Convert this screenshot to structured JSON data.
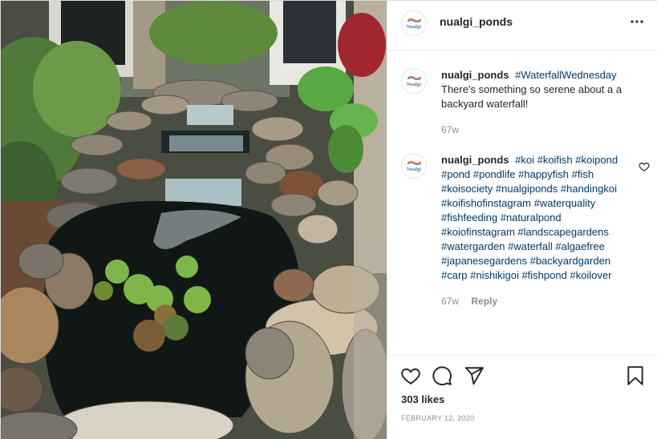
{
  "header": {
    "username": "nualgi_ponds",
    "avatar_icon": "nualgi-logo-icon",
    "avatar_text": "Nualgi",
    "more_icon": "more-options-icon"
  },
  "caption": {
    "username": "nualgi_ponds",
    "hashtag": "#WaterfallWednesday",
    "text": "There's something so serene about a a backyard waterfall!",
    "time": "67w"
  },
  "comment": {
    "username": "nualgi_ponds",
    "hashtags": "#koi #koifish #koipond #pond #pondlife #happyfish #fish #koisociety #nualgiponds #handingkoi #koifishofinstagram #waterquality #fishfeeding #naturalpond #koiofinstagram #landscapegardens #watergarden #waterfall #algaefree #japanesegardens #backyardgarden #carp #nishikigoi #fishpond #koilover",
    "time": "67w",
    "reply_label": "Reply",
    "like_icon": "heart-outline-icon"
  },
  "actions": {
    "like_icon": "heart-icon",
    "comment_icon": "comment-bubble-icon",
    "share_icon": "paper-plane-icon",
    "save_icon": "bookmark-icon"
  },
  "likes": "303 likes",
  "date": "FEBRUARY 12, 2020",
  "colors": {
    "text": "#262626",
    "hashtag": "#00376b",
    "muted": "#8e8e8e",
    "border": "#dbdbdb"
  }
}
